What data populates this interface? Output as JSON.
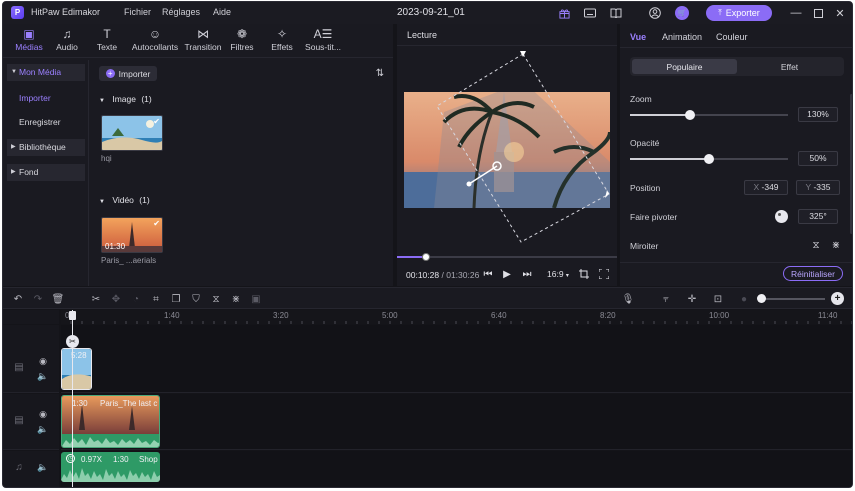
{
  "titlebar": {
    "app_name": "HitPaw Edimakor",
    "menus": [
      "Fichier",
      "Réglages",
      "Aide"
    ],
    "doc_title": "2023-09-21_01",
    "export_label": "Exporter"
  },
  "media_tabs": [
    {
      "label": "Médias",
      "icon": "media-icon"
    },
    {
      "label": "Audio",
      "icon": "music-note-icon"
    },
    {
      "label": "Texte",
      "icon": "text-icon"
    },
    {
      "label": "Autocollants",
      "icon": "sticker-icon"
    },
    {
      "label": "Transition",
      "icon": "transition-icon"
    },
    {
      "label": "Filtres",
      "icon": "filter-icon"
    },
    {
      "label": "Effets",
      "icon": "sparkle-icon"
    },
    {
      "label": "Sous-tit...",
      "icon": "subtitle-icon"
    }
  ],
  "sidebar": {
    "mon_media": "Mon Média",
    "importer": "Importer",
    "enregistrer": "Enregistrer",
    "bibliotheque": "Bibliothèque",
    "fond": "Fond"
  },
  "media": {
    "import_label": "Importer",
    "image_group": "Image",
    "image_count": "(1)",
    "image_name": "hqi",
    "video_group": "Vidéo",
    "video_count": "(1)",
    "video_duration": "01:30",
    "video_name": "Paris_ ...aerials"
  },
  "preview": {
    "title": "Lecture",
    "current_time": "00:10:28",
    "separator": "/",
    "total_time": "01:30:26",
    "aspect": "16:9",
    "progress_fraction": 0.13
  },
  "properties": {
    "tabs": [
      "Vue",
      "Animation",
      "Couleur"
    ],
    "segments": [
      "Populaire",
      "Effet"
    ],
    "zoom_label": "Zoom",
    "zoom_value": "130%",
    "zoom_fraction": 0.38,
    "opacity_label": "Opacité",
    "opacity_value": "50%",
    "opacity_fraction": 0.5,
    "position_label": "Position",
    "pos_x_prefix": "X",
    "pos_x": "-349",
    "pos_y_prefix": "Y",
    "pos_y": "-335",
    "rotate_label": "Faire pivoter",
    "rotate_value": "325°",
    "mirror_label": "Miroiter",
    "reset_label": "Réinitialiser"
  },
  "timeline": {
    "ruler_labels": [
      "00",
      "1:40",
      "3:20",
      "5:00",
      "6:40",
      "8:20",
      "10:00",
      "11:40"
    ],
    "image_clip_label": "5:28",
    "video_clip_duration": "1:30",
    "video_clip_name": "Paris_The last c",
    "audio_speed": "0.97X",
    "audio_duration": "1:30",
    "audio_name": "Shop"
  }
}
